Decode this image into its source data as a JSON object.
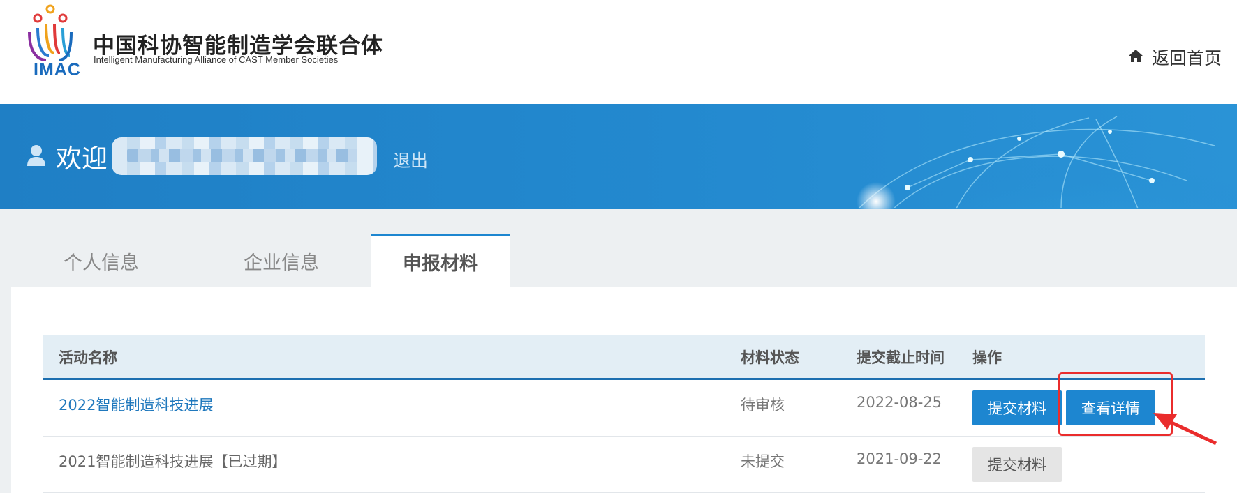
{
  "header": {
    "logo_abbr": "IMAC",
    "org_name_cn": "中国科协智能制造学会联合体",
    "org_name_en": "Intelligent Manufacturing Alliance of CAST Member Societies",
    "home_link_label": "返回首页",
    "home_icon": "home-icon"
  },
  "banner": {
    "welcome_text": "欢迎",
    "user_icon": "user-icon",
    "logout_label": "退出"
  },
  "tabs": [
    {
      "label": "个人信息",
      "active": false
    },
    {
      "label": "企业信息",
      "active": false
    },
    {
      "label": "申报材料",
      "active": true
    }
  ],
  "table": {
    "headers": [
      "活动名称",
      "材料状态",
      "提交截止时间",
      "操作"
    ],
    "rows": [
      {
        "name": "2022智能制造科技进展",
        "status": "待审核",
        "deadline": "2022-08-25",
        "actions": [
          "提交材料",
          "查看详情"
        ]
      },
      {
        "name": "2021智能制造科技进展【已过期】",
        "status": "未提交",
        "deadline": "2021-09-22",
        "actions": [
          "提交材料"
        ]
      }
    ]
  },
  "colors": {
    "accent": "#1d86d0",
    "banner": "#2389cf",
    "highlight": "#ea2c2c"
  }
}
